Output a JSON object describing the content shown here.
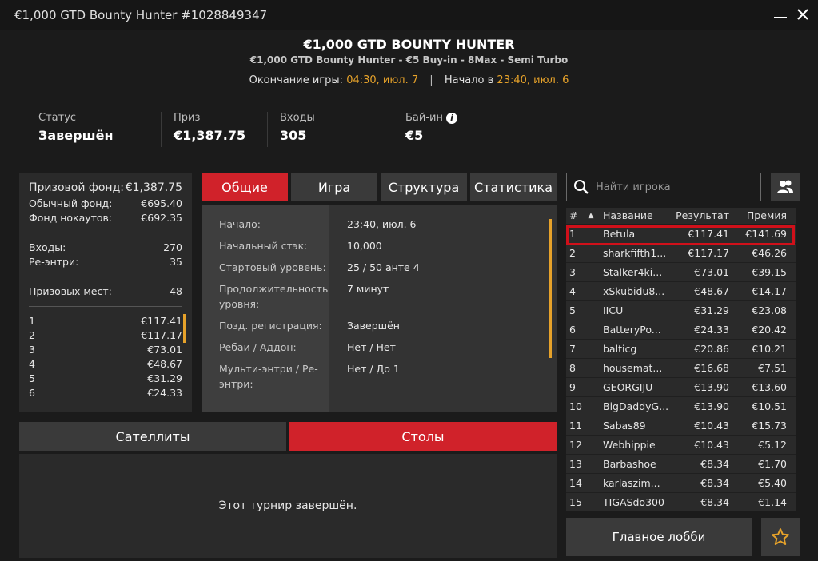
{
  "window": {
    "title": "€1,000 GTD Bounty Hunter #1028849347"
  },
  "header": {
    "title": "€1,000 GTD BOUNTY HUNTER",
    "subtitle": "€1,000 GTD Bounty Hunter - €5 Buy-in - 8Max - Semi Turbo",
    "end_label": "Окончание игры:",
    "end_value": "04:30, июл. 7",
    "separator": "|",
    "start_label": "Начало в",
    "start_value": "23:40, июл. 6"
  },
  "stats": {
    "status": {
      "label": "Статус",
      "value": "Завершён"
    },
    "prize": {
      "label": "Приз",
      "value": "€1,387.75"
    },
    "entries": {
      "label": "Входы",
      "value": "305"
    },
    "buyin": {
      "label": "Бай-ин",
      "value": "€5",
      "info_icon": "i"
    }
  },
  "prize_panel": {
    "pool": {
      "label": "Призовой фонд:",
      "value": "€1,387.75"
    },
    "regular": {
      "label": "Обычный фонд:",
      "value": "€695.40"
    },
    "knockout": {
      "label": "Фонд нокаутов:",
      "value": "€692.35"
    },
    "entries": {
      "label": "Входы:",
      "value": "270"
    },
    "reentries": {
      "label": "Ре-энтри:",
      "value": "35"
    },
    "places": {
      "label": "Призовых мест:",
      "value": "48"
    },
    "payouts": [
      {
        "place": "1",
        "amount": "€117.41"
      },
      {
        "place": "2",
        "amount": "€117.17"
      },
      {
        "place": "3",
        "amount": "€73.01"
      },
      {
        "place": "4",
        "amount": "€48.67"
      },
      {
        "place": "5",
        "amount": "€31.29"
      },
      {
        "place": "6",
        "amount": "€24.33"
      }
    ]
  },
  "tabs": [
    {
      "label": "Общие"
    },
    {
      "label": "Игра"
    },
    {
      "label": "Структура"
    },
    {
      "label": "Статистика"
    }
  ],
  "details": [
    {
      "label": "Начало:",
      "value": "23:40, июл. 6"
    },
    {
      "label": "Начальный стэк:",
      "value": "10,000"
    },
    {
      "label": "Стартовый уровень:",
      "value": "25 / 50 анте 4"
    },
    {
      "label": "Продолжительность уровня:",
      "value": "7 минут"
    },
    {
      "label": "Позд. регистрация:",
      "value": "Завершён"
    },
    {
      "label": "Ребаи / Аддон:",
      "value": "Нет / Нет"
    },
    {
      "label": "Мульти-энтри / Ре-энтри:",
      "value": "Нет / До 1"
    }
  ],
  "bottom_tabs": [
    {
      "label": "Сателлиты"
    },
    {
      "label": "Столы"
    }
  ],
  "bottom_message": "Этот турнир завершён.",
  "search": {
    "placeholder": "Найти игрока"
  },
  "players_table": {
    "headers": {
      "num": "#",
      "sort": "▲",
      "name": "Название",
      "result": "Результат",
      "prize": "Премия"
    },
    "rows": [
      {
        "num": "1",
        "name": "Betula",
        "result": "€117.41",
        "prize": "€141.69"
      },
      {
        "num": "2",
        "name": "sharkfifth1...",
        "result": "€117.17",
        "prize": "€46.26"
      },
      {
        "num": "3",
        "name": "Stalker4ki...",
        "result": "€73.01",
        "prize": "€39.15"
      },
      {
        "num": "4",
        "name": "xSkubidu8...",
        "result": "€48.67",
        "prize": "€14.17"
      },
      {
        "num": "5",
        "name": "IICU",
        "result": "€31.29",
        "prize": "€23.08"
      },
      {
        "num": "6",
        "name": "BatteryPo...",
        "result": "€24.33",
        "prize": "€20.42"
      },
      {
        "num": "7",
        "name": "balticg",
        "result": "€20.86",
        "prize": "€10.21"
      },
      {
        "num": "8",
        "name": "housemat...",
        "result": "€16.68",
        "prize": "€7.51"
      },
      {
        "num": "9",
        "name": "GEORGIJU",
        "result": "€13.90",
        "prize": "€13.60"
      },
      {
        "num": "10",
        "name": "BigDaddyG...",
        "result": "€13.90",
        "prize": "€10.51"
      },
      {
        "num": "11",
        "name": "Sabas89",
        "result": "€10.43",
        "prize": "€15.73"
      },
      {
        "num": "12",
        "name": "Webhippie",
        "result": "€10.43",
        "prize": "€5.12"
      },
      {
        "num": "13",
        "name": "Barbashoe",
        "result": "€8.34",
        "prize": "€1.70"
      },
      {
        "num": "14",
        "name": "karlaszim...",
        "result": "€8.34",
        "prize": "€5.40"
      },
      {
        "num": "15",
        "name": "TIGASdo300",
        "result": "€8.34",
        "prize": "€1.14"
      }
    ]
  },
  "lobby_button": {
    "label": "Главное лобби"
  },
  "colors": {
    "accent": "#d0222a",
    "highlight": "#e6a22a"
  }
}
